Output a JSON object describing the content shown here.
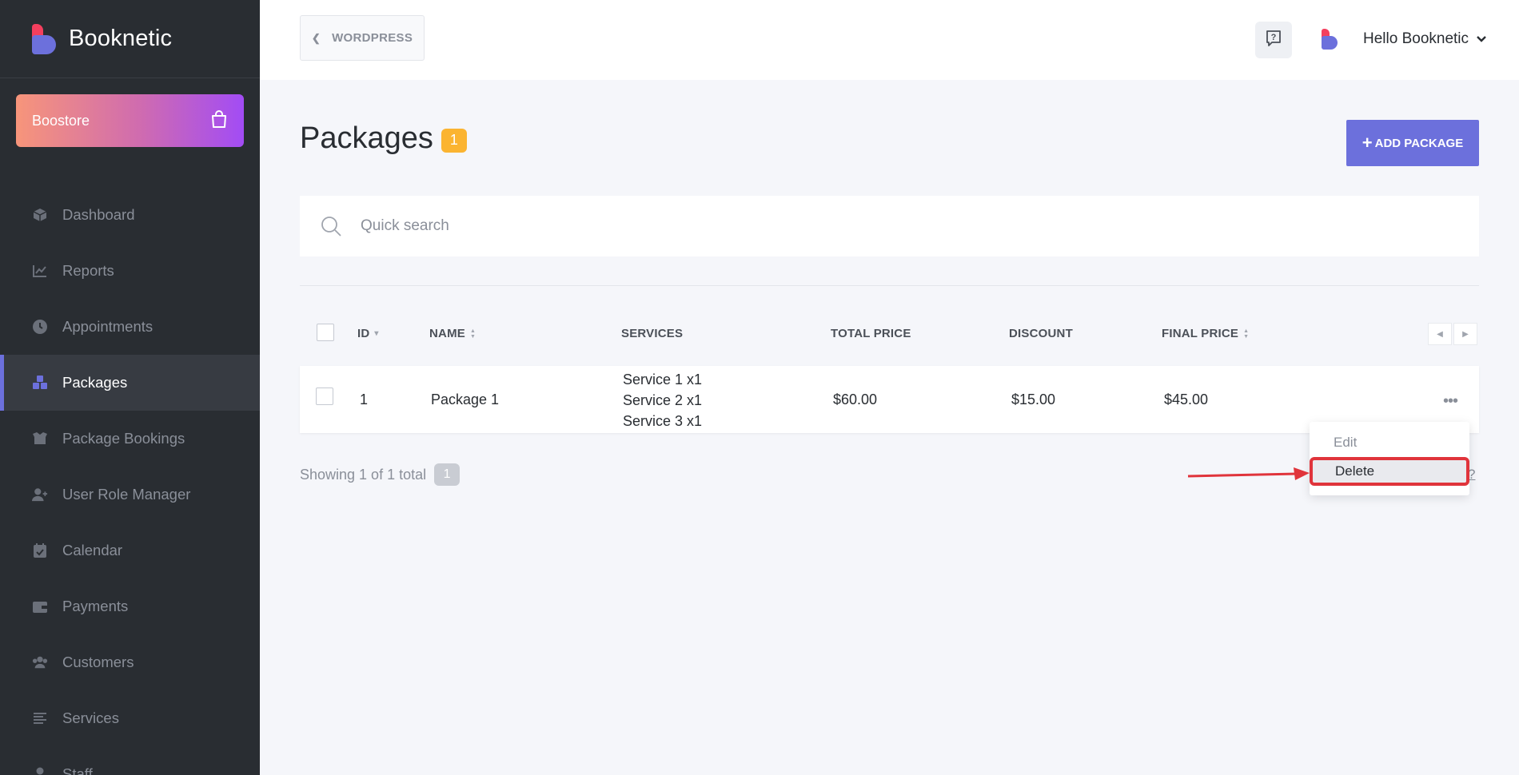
{
  "brand": {
    "name": "Booknetic"
  },
  "boostore": {
    "label": "Boostore"
  },
  "sidebar": {
    "items": [
      {
        "label": "Dashboard",
        "icon": "cube-icon",
        "active": false
      },
      {
        "label": "Reports",
        "icon": "chart-line-icon",
        "active": false
      },
      {
        "label": "Appointments",
        "icon": "clock-icon",
        "active": false
      },
      {
        "label": "Packages",
        "icon": "cubes-icon",
        "active": true
      },
      {
        "label": "Package Bookings",
        "icon": "box-open-icon",
        "active": false
      },
      {
        "label": "User Role Manager",
        "icon": "user-plus-icon",
        "active": false
      },
      {
        "label": "Calendar",
        "icon": "calendar-check-icon",
        "active": false
      },
      {
        "label": "Payments",
        "icon": "wallet-icon",
        "active": false
      },
      {
        "label": "Customers",
        "icon": "users-icon",
        "active": false
      },
      {
        "label": "Services",
        "icon": "list-icon",
        "active": false
      },
      {
        "label": "Staff",
        "icon": "user-icon",
        "active": false
      }
    ]
  },
  "header": {
    "back_label": "WORDPRESS",
    "user_greeting": "Hello Booknetic"
  },
  "page": {
    "title": "Packages",
    "count": "1",
    "add_label": "ADD PACKAGE"
  },
  "search": {
    "placeholder": "Quick search"
  },
  "table": {
    "columns": {
      "id": "ID",
      "name": "NAME",
      "services": "SERVICES",
      "total_price": "TOTAL PRICE",
      "discount": "DISCOUNT",
      "final_price": "FINAL PRICE"
    },
    "rows": [
      {
        "id": "1",
        "name": "Package 1",
        "services": [
          "Service 1 x1",
          "Service 2 x1",
          "Service 3 x1"
        ],
        "total_price": "$60.00",
        "discount": "$15.00",
        "final_price": "$45.00"
      }
    ]
  },
  "footer": {
    "showing": "Showing 1 of 1 total",
    "page": "1",
    "help": "?"
  },
  "row_menu": {
    "edit": "Edit",
    "delete": "Delete"
  },
  "colors": {
    "accent": "#6c70dc",
    "sidebar": "#292d32",
    "badge": "#fbb431",
    "highlight": "#e0343b"
  }
}
